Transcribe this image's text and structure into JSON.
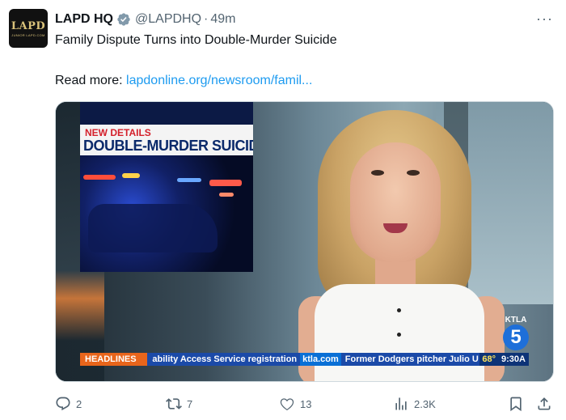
{
  "author": {
    "name": "LAPD HQ",
    "handle": "@LAPDHQ",
    "separator": "·",
    "time": "49m",
    "avatar_text": "LAPD",
    "avatar_subtext": "JUNIOR LAPD.COM"
  },
  "more_label": "···",
  "tweet": {
    "text": "Family Dispute Turns into Double-Murder Suicide",
    "read_more_prefix": "Read more: ",
    "link_text": "lapdonline.org/newsroom/famil..."
  },
  "media": {
    "inset_new": "NEW DETAILS",
    "inset_title": "DOUBLE-MURDER SUICIDE",
    "ticker": {
      "headlines": "HEADLINES",
      "news1": "ability Access Service registration",
      "site": "ktla.com",
      "news2": "Former Dodgers pitcher Julio U",
      "temp": "68°",
      "clock": "9:30A"
    },
    "station_text": "KTLA",
    "station_num": "5"
  },
  "actions": {
    "replies": "2",
    "reposts": "7",
    "likes": "13",
    "views": "2.3K"
  },
  "colors": {
    "link": "#1d9bf0",
    "secondary": "#536471",
    "verified": "#829aab"
  }
}
